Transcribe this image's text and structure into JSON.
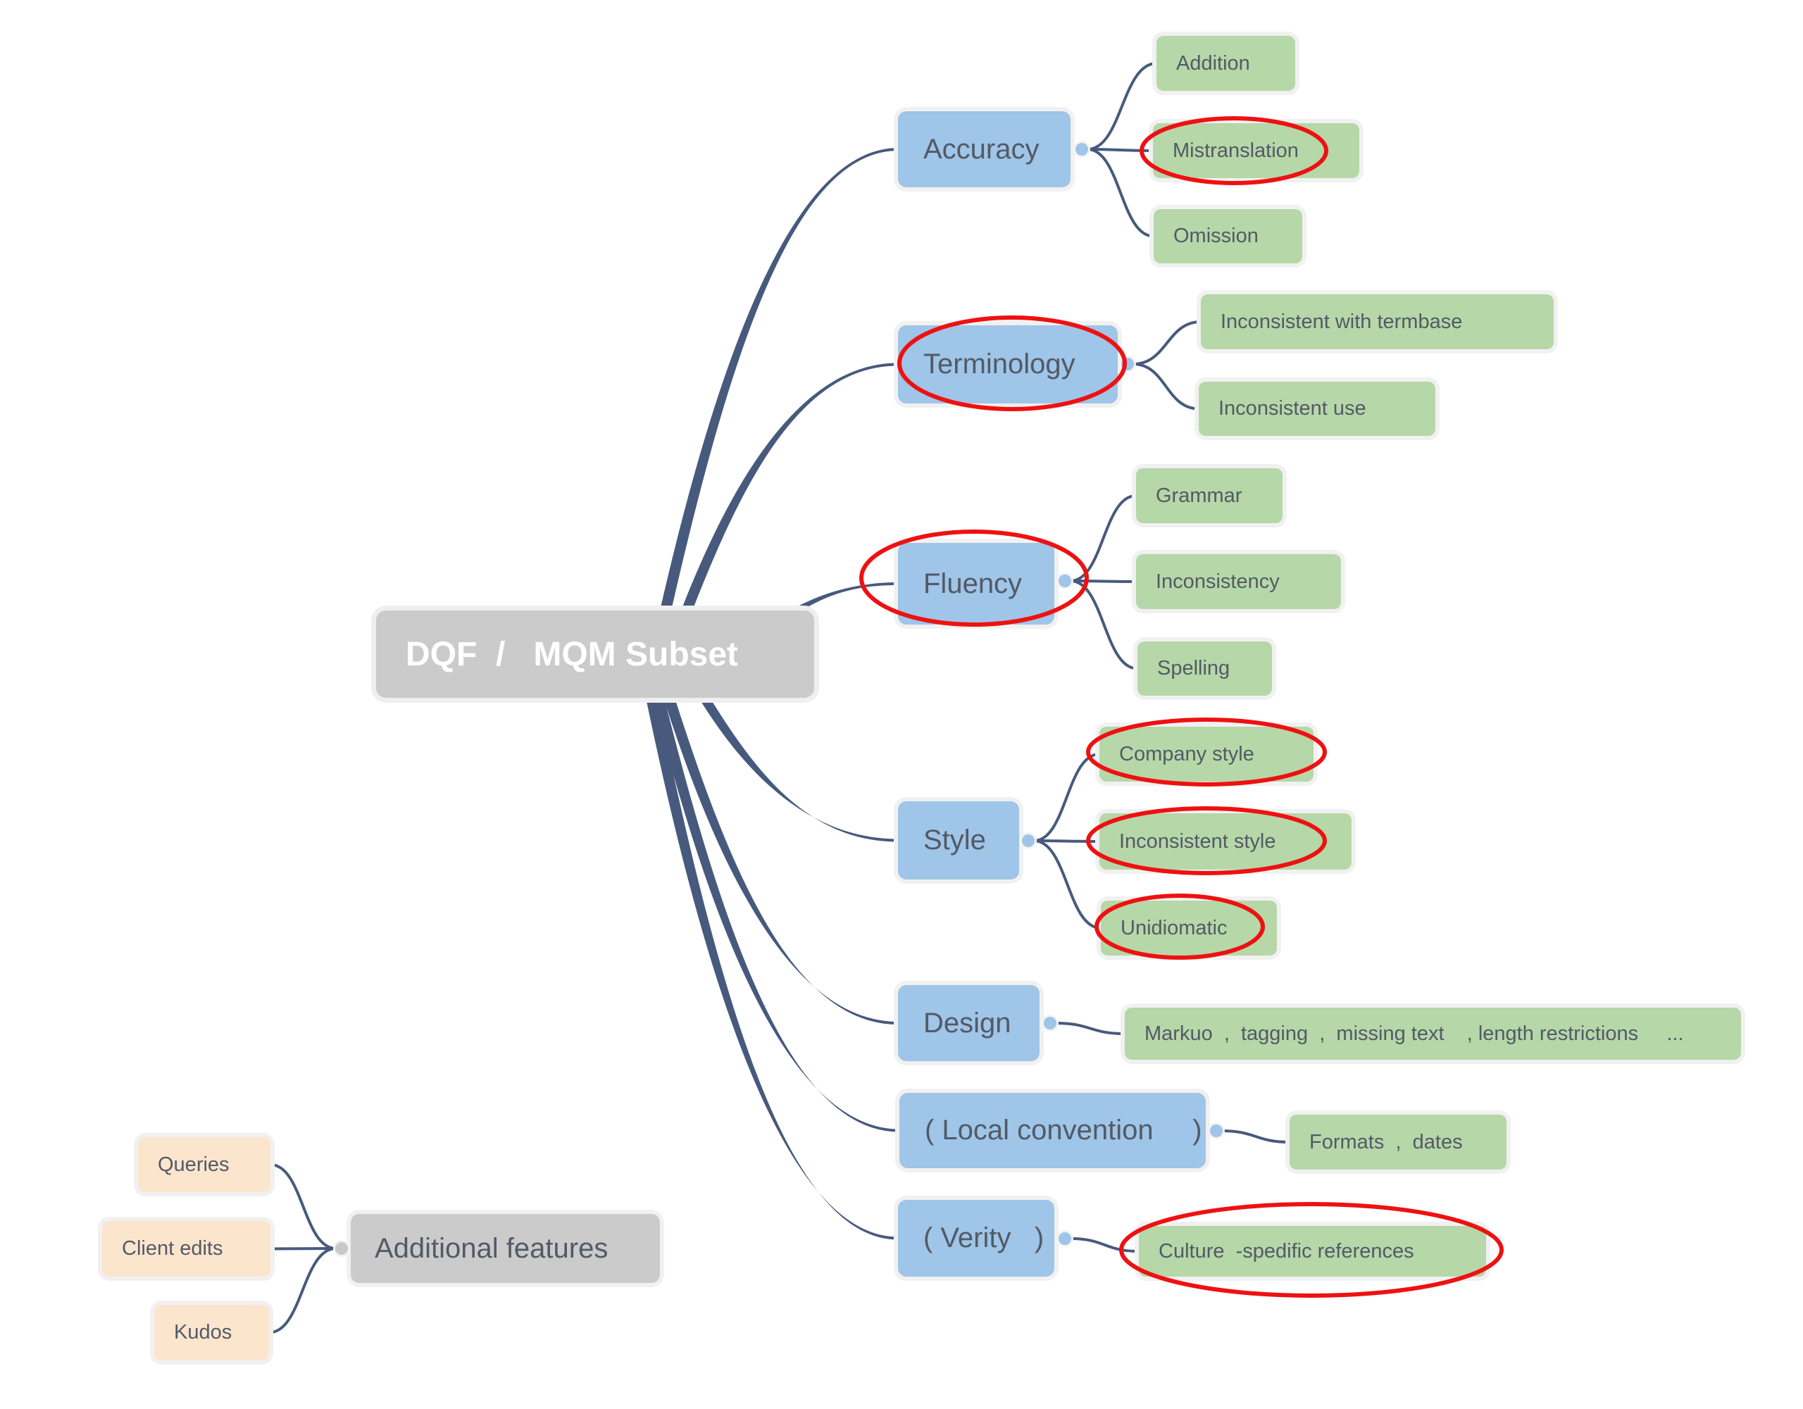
{
  "diagram": {
    "type": "mind-map",
    "root": {
      "label": "DQF  /   MQM Subset"
    },
    "branches": [
      {
        "label": "Accuracy",
        "children": [
          "Addition",
          "Mistranslation",
          "Omission"
        ]
      },
      {
        "label": "Terminology",
        "children": [
          "Inconsistent with termbase",
          "Inconsistent use"
        ]
      },
      {
        "label": "Fluency",
        "children": [
          "Grammar",
          "Inconsistency",
          "Spelling"
        ]
      },
      {
        "label": "Style",
        "children": [
          "Company style",
          "Inconsistent style",
          "Unidiomatic"
        ]
      },
      {
        "label": "Design",
        "children": [
          "Markuo  ,  tagging  ,  missing text    , length restrictions     ..."
        ]
      },
      {
        "label": "( Local convention     )",
        "children": [
          "Formats  ,  dates"
        ]
      },
      {
        "label": "( Verity   )",
        "children": [
          "Culture  -spedific references"
        ]
      }
    ],
    "additional": {
      "label": "Additional features",
      "children": [
        "Queries",
        "Client edits",
        "Kudos"
      ]
    },
    "highlighted": [
      "Mistranslation",
      "Terminology",
      "Fluency",
      "Company style",
      "Inconsistent style",
      "Unidiomatic",
      "Culture  -spedific references"
    ],
    "colors": {
      "root": "#cbcbcb",
      "branch": "#9fc5e8",
      "leaf": "#b6d7a8",
      "additional_leaf": "#fce5cd",
      "connector": "#475a7d",
      "highlight": "#ee1111",
      "text": "#525a66"
    }
  }
}
